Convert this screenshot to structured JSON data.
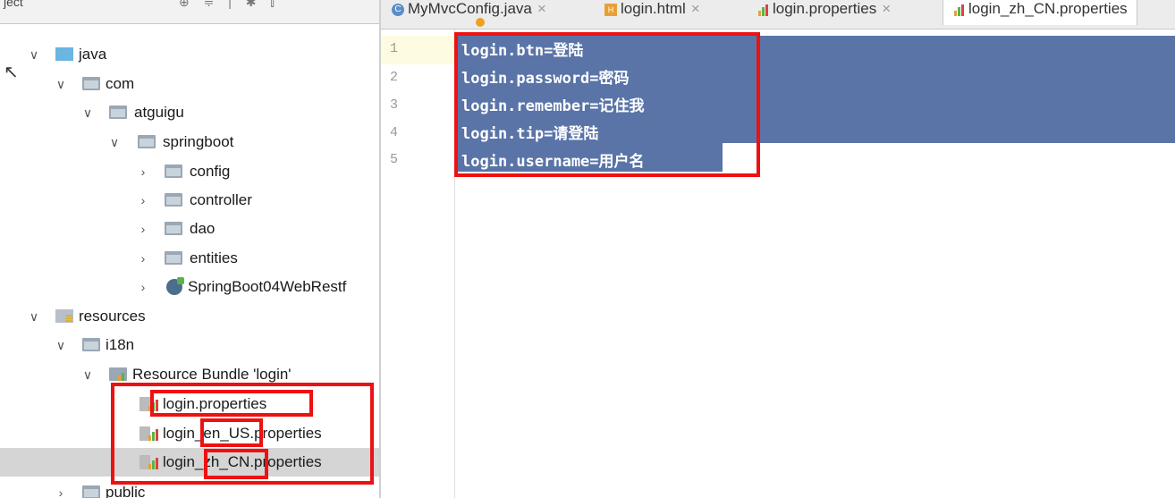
{
  "tree": {
    "header_title": "ject",
    "rows": [
      {
        "label": "java",
        "expanded": true
      },
      {
        "label": "com",
        "expanded": true
      },
      {
        "label": "atguigu",
        "expanded": true
      },
      {
        "label": "springboot",
        "expanded": true
      },
      {
        "label": "config",
        "expanded": false
      },
      {
        "label": "controller",
        "expanded": false
      },
      {
        "label": "dao",
        "expanded": false
      },
      {
        "label": "entities",
        "expanded": false
      },
      {
        "label": "SpringBoot04WebRestf",
        "expanded": false
      },
      {
        "label": "resources",
        "expanded": true
      },
      {
        "label": "i18n",
        "expanded": true
      },
      {
        "label": "Resource Bundle 'login'",
        "expanded": true
      },
      {
        "label": "login.properties"
      },
      {
        "label": "login_en_US.properties"
      },
      {
        "label": "login_zh_CN.properties",
        "selected": true
      },
      {
        "label": "public",
        "expanded": false
      }
    ]
  },
  "tabs": [
    {
      "label": "MyMvcConfig.java",
      "icon": "class-icon"
    },
    {
      "label": "login.html",
      "icon": "html-icon"
    },
    {
      "label": "login.properties",
      "icon": "properties-icon"
    },
    {
      "label": "login_zh_CN.properties",
      "icon": "properties-icon",
      "active": true
    }
  ],
  "editor": {
    "line_numbers": [
      "1",
      "2",
      "3",
      "4",
      "5"
    ],
    "lines": [
      "login.btn=登陆",
      "login.password=密码",
      "login.remember=记住我",
      "login.tip=请登陆",
      "login.username=用户名"
    ]
  },
  "colors": {
    "selection": "#5a74a8",
    "highlight_box": "#ee1111",
    "accent_bars": [
      "#e8a035",
      "#5bb24a",
      "#e04040"
    ]
  }
}
